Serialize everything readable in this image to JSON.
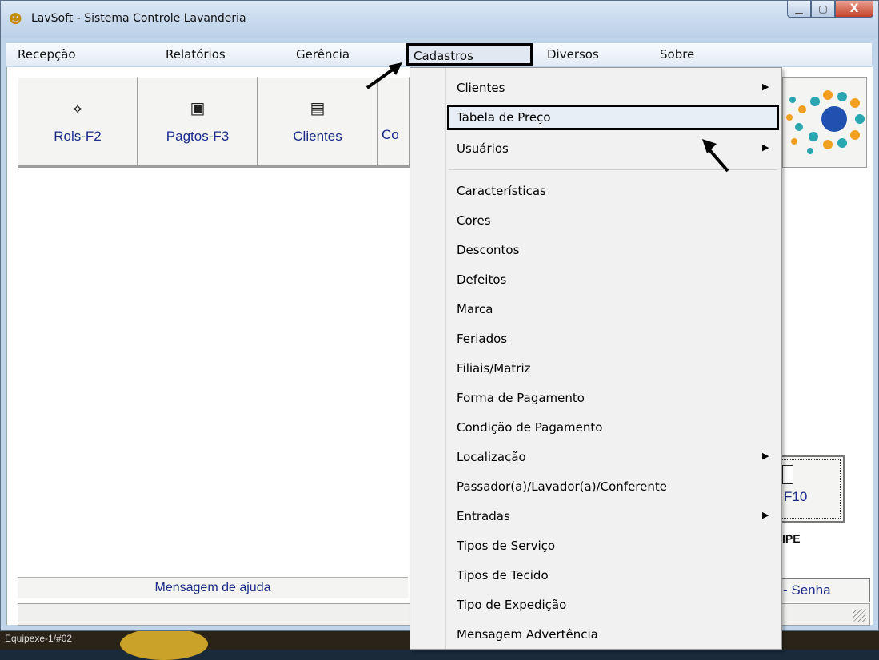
{
  "window": {
    "title": "LavSoft - Sistema Controle Lavanderia",
    "buttons": {
      "minimize": "▁",
      "maximize": "▢",
      "close": "X"
    }
  },
  "menubar": {
    "items": [
      {
        "label": "Recepção"
      },
      {
        "label": "Relatórios"
      },
      {
        "label": "Gerência"
      },
      {
        "label": "Cadastros",
        "active": true
      },
      {
        "label": "Diversos"
      },
      {
        "label": "Sobre"
      }
    ]
  },
  "toolbar": {
    "buttons": [
      {
        "label": "Rols-F2",
        "icon": "book-icon"
      },
      {
        "label": "Pagtos-F3",
        "icon": "register-icon"
      },
      {
        "label": "Clientes",
        "icon": "document-icon"
      },
      {
        "label": "Co",
        "icon": ""
      }
    ]
  },
  "dropdown": {
    "items": [
      {
        "label": "Clientes",
        "submenu": true
      },
      {
        "label": "Tabela de Preço",
        "submenu": false,
        "highlighted": true
      },
      {
        "label": "Usuários",
        "submenu": true
      },
      {
        "label": "Características",
        "submenu": false
      },
      {
        "label": "Cores",
        "submenu": false
      },
      {
        "label": "Descontos",
        "submenu": false
      },
      {
        "label": "Defeitos",
        "submenu": false
      },
      {
        "label": "Marca",
        "submenu": false
      },
      {
        "label": "Feriados",
        "submenu": false
      },
      {
        "label": "Filiais/Matriz",
        "submenu": false
      },
      {
        "label": "Forma de Pagamento",
        "submenu": false
      },
      {
        "label": "Condição de Pagamento",
        "submenu": false
      },
      {
        "label": "Localização",
        "submenu": true
      },
      {
        "label": "Passador(a)/Lavador(a)/Conferente",
        "submenu": false
      },
      {
        "label": "Entradas",
        "submenu": true
      },
      {
        "label": "Tipos de Serviço",
        "submenu": false
      },
      {
        "label": "Tipos de Tecido",
        "submenu": false
      },
      {
        "label": "Tipo de Expedição",
        "submenu": false
      },
      {
        "label": "Mensagem Advertência",
        "submenu": false
      }
    ],
    "submenu_arrow": "▶"
  },
  "panel": {
    "f10_label": "F10",
    "ipe_label": "IPE",
    "senha_label": "- Senha",
    "help_message": "Mensagem de ajuda"
  },
  "desktop": {
    "label": "Equipexe-1/#02"
  },
  "colors": {
    "menu_bg": "#f1f1f1",
    "button_text": "#1a2a8a",
    "title_bar": "#c6d8ec",
    "highlight_border": "#000000"
  }
}
